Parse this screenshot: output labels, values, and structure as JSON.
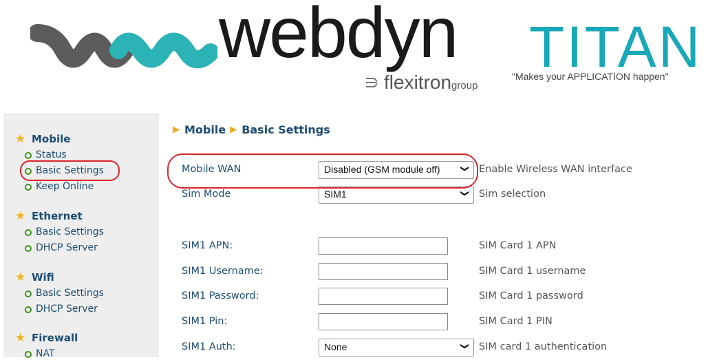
{
  "header": {
    "brand": "webdyn",
    "group_name": "flexitron",
    "group_suffix": "group",
    "product": "TITAN",
    "tagline": "\"Makes your APPLICATION happen\""
  },
  "sidebar": {
    "sections": [
      {
        "title": "Mobile",
        "items": [
          "Status",
          "Basic Settings",
          "Keep Online"
        ]
      },
      {
        "title": "Ethernet",
        "items": [
          "Basic Settings",
          "DHCP Server"
        ]
      },
      {
        "title": "Wifi",
        "items": [
          "Basic Settings",
          "DHCP Server"
        ]
      },
      {
        "title": "Firewall",
        "items": [
          "NAT"
        ]
      }
    ],
    "active": "Basic Settings"
  },
  "breadcrumb": {
    "level1": "Mobile",
    "level2": "Basic Settings"
  },
  "form": {
    "mobile_wan": {
      "label": "Mobile WAN",
      "value": "Disabled (GSM module off)",
      "help": "Enable Wireless WAN interface"
    },
    "sim_mode": {
      "label": "Sim Mode",
      "value": "SIM1",
      "help": "Sim selection"
    },
    "sim1_apn": {
      "label": "SIM1 APN:",
      "value": "",
      "help": "SIM Card 1 APN"
    },
    "sim1_username": {
      "label": "SIM1 Username:",
      "value": "",
      "help": "SIM Card 1 username"
    },
    "sim1_password": {
      "label": "SIM1 Password:",
      "value": "",
      "help": "SIM Card 1 password"
    },
    "sim1_pin": {
      "label": "SIM1 Pin:",
      "value": "",
      "help": "SIM Card 1 PIN"
    },
    "sim1_auth": {
      "label": "SIM1 Auth:",
      "value": "None",
      "help": "SIM card 1 authentication"
    }
  },
  "colors": {
    "accent": "#1d4d74",
    "titan": "#18a8b8",
    "highlight": "#d9252a",
    "star": "#f2b222"
  }
}
